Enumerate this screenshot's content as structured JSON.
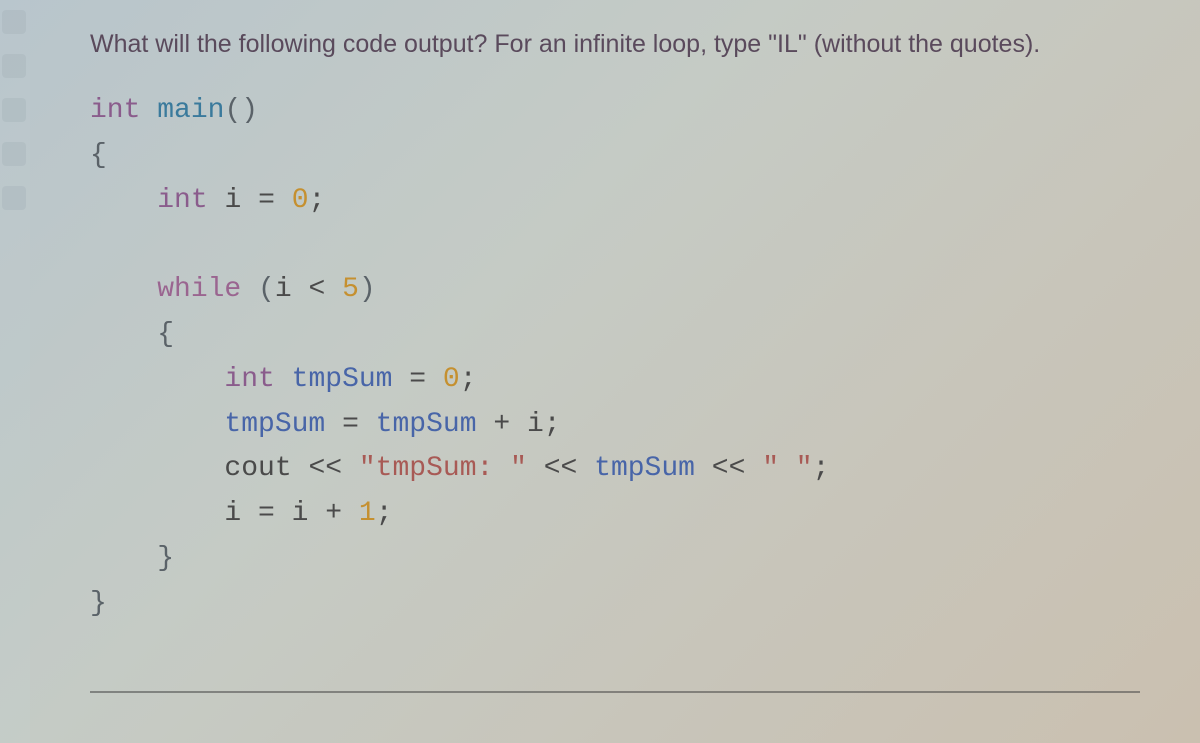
{
  "question": "What will the following code output? For an infinite loop, type \"IL\" (without the quotes).",
  "code": {
    "line1": {
      "kw1": "int",
      "fn": "main",
      "paren": "()"
    },
    "line2": "{",
    "line3": {
      "kw": "int",
      "var": "i",
      "eq": "=",
      "val": "0",
      "semi": ";"
    },
    "line4": {
      "kw": "while",
      "open": "(",
      "var": "i",
      "op": "<",
      "val": "5",
      "close": ")"
    },
    "line5": "{",
    "line6": {
      "kw": "int",
      "var": "tmpSum",
      "eq": "=",
      "val": "0",
      "semi": ";"
    },
    "line7": {
      "lhs": "tmpSum",
      "eq": "=",
      "rhs1": "tmpSum",
      "op": "+",
      "rhs2": "i",
      "semi": ";"
    },
    "line8": {
      "cout": "cout",
      "s1": "<<",
      "str1": "\"tmpSum: \"",
      "s2": "<<",
      "var": "tmpSum",
      "s3": "<<",
      "str2": "\" \"",
      "semi": ";"
    },
    "line9": {
      "lhs": "i",
      "eq": "=",
      "rhs1": "i",
      "op": "+",
      "rhs2": "1",
      "semi": ";"
    },
    "line10": "}",
    "line11": "}"
  }
}
